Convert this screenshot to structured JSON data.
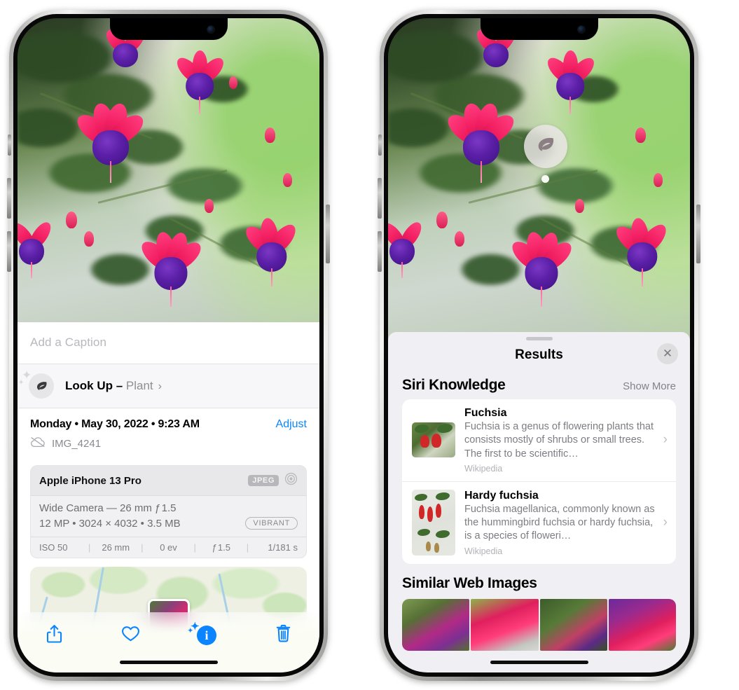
{
  "left_phone": {
    "caption_placeholder": "Add a Caption",
    "lookup": {
      "icon": "leaf-icon",
      "label": "Look Up – ",
      "subject": "Plant",
      "chevron": "›"
    },
    "meta": {
      "date": "Monday • May 30, 2022 • 9:23 AM",
      "adjust_label": "Adjust",
      "cloud_icon": "cloud-slash-icon",
      "filename": "IMG_4241"
    },
    "exif": {
      "device": "Apple iPhone 13 Pro",
      "format_badge": "JPEG",
      "raw_icon": "aperture-icon",
      "lens_line": "Wide Camera — 26 mm ƒ 1.5",
      "resolution_line": "12 MP • 3024 × 4032 • 3.5 MB",
      "style_badge": "VIBRANT",
      "stats": [
        "ISO 50",
        "26 mm",
        "0 ev",
        "ƒ 1.5",
        "1/181 s"
      ],
      "stat_separator": "|"
    },
    "toolbar": {
      "share_label": "share-icon",
      "favorite_label": "heart-icon",
      "info_label": "i",
      "delete_label": "trash-icon"
    }
  },
  "right_phone": {
    "badge": {
      "icon": "leaf-icon"
    },
    "sheet": {
      "title": "Results",
      "close_label": "✕"
    },
    "siri_knowledge": {
      "title": "Siri Knowledge",
      "action": "Show More",
      "items": [
        {
          "title": "Fuchsia",
          "description": "Fuchsia is a genus of flowering plants that consists mostly of shrubs or small trees. The first to be scientific…",
          "source": "Wikipedia",
          "chevron": "›"
        },
        {
          "title": "Hardy fuchsia",
          "description": "Fuchsia magellanica, commonly known as the hummingbird fuchsia or hardy fuchsia, is a species of floweri…",
          "source": "Wikipedia",
          "chevron": "›"
        }
      ]
    },
    "similar_web_images": {
      "title": "Similar Web Images",
      "count": 4
    }
  },
  "colors": {
    "accent_blue": "#0a84ff",
    "sheet_gray": "#f0f0f4",
    "card_white": "#ffffff",
    "secondary_text": "#8e8e93"
  }
}
